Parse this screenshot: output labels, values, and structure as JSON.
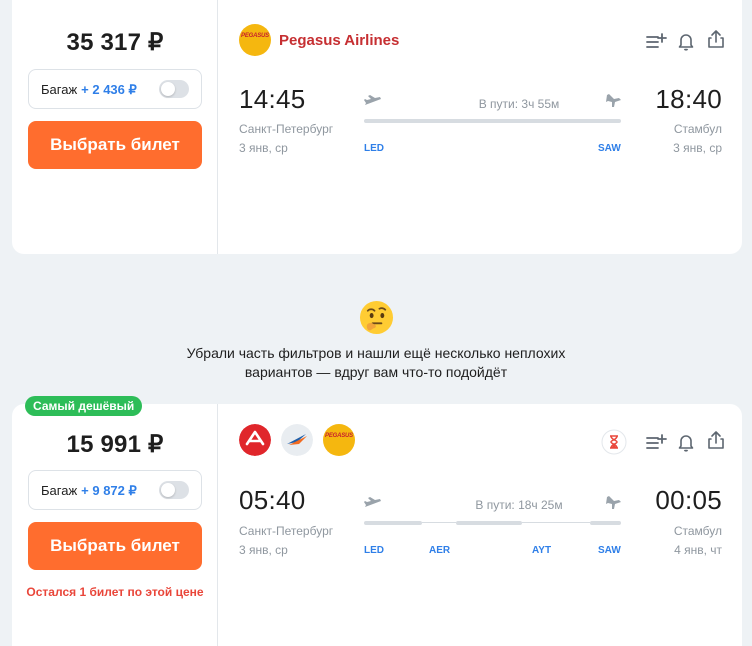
{
  "offers": [
    {
      "price": "35 317 ₽",
      "baggage_label": "Багаж",
      "baggage_price": "+ 2 436 ₽",
      "button": "Выбрать билет",
      "airline": "Pegasus Airlines",
      "logo_text": "PEGASUS",
      "depart_time": "14:45",
      "arrive_time": "18:40",
      "depart_city": "Санкт-Петербург",
      "arrive_city": "Стамбул",
      "depart_date": "3 янв, ср",
      "arrive_date": "3 янв, ср",
      "duration": "В пути: 3ч 55м",
      "airports": [
        "LED",
        "SAW"
      ]
    },
    {
      "badge": "Самый дешёвый",
      "price": "15 991 ₽",
      "baggage_label": "Багаж",
      "baggage_price": "+ 9 872 ₽",
      "button": "Выбрать билет",
      "remaining": "Остался 1 билет по этой цене",
      "logo_text": "PEGASUS",
      "depart_time": "05:40",
      "arrive_time": "00:05",
      "depart_city": "Санкт-Петербург",
      "arrive_city": "Стамбул",
      "depart_date": "3 янв, ср",
      "arrive_date": "4 янв, чт",
      "duration": "В пути: 18ч 25м",
      "airports": [
        "LED",
        "AER",
        "AYT",
        "SAW"
      ]
    }
  ],
  "info_message": "Убрали часть фильтров и нашли ещё несколько неплохих вариантов — вдруг вам что-то подойдёт",
  "info_message_lines": [
    "Убрали часть фильтров и нашли ещё несколько неплохих",
    "вариантов — вдруг вам что-то подойдёт"
  ],
  "colors": {
    "accent_button": "#ff6d2e",
    "price_extra": "#2f7fe8",
    "badge": "#2dbd58",
    "warning": "#e9463a",
    "airline_red": "#c62f32"
  }
}
